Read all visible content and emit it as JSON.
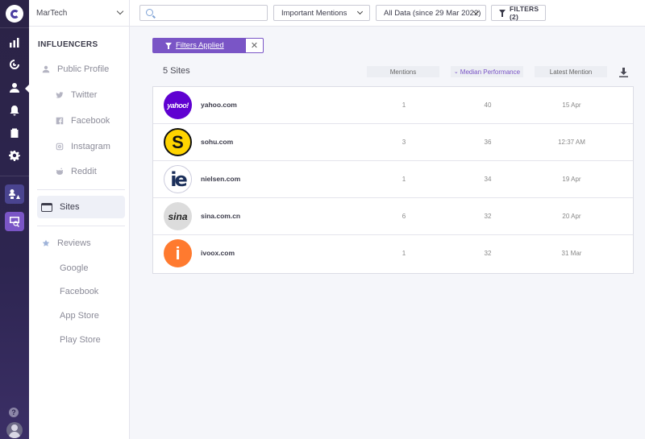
{
  "workspace": {
    "name": "MarTech"
  },
  "topbar": {
    "search_placeholder": "",
    "mentions_filter": "Important Mentions",
    "date_filter": "All Data (since 29 Mar 2022)",
    "filters_label": "FILTERS (2)"
  },
  "sidebar": {
    "section_title": "INFLUENCERS",
    "items": [
      {
        "label": "Public Profile",
        "icon": "person-icon"
      },
      {
        "label": "Twitter",
        "icon": "twitter-icon"
      },
      {
        "label": "Facebook",
        "icon": "facebook-icon"
      },
      {
        "label": "Instagram",
        "icon": "instagram-icon"
      },
      {
        "label": "Reddit",
        "icon": "reddit-icon"
      }
    ],
    "active_item": {
      "label": "Sites",
      "icon": "window-icon"
    },
    "reviews": {
      "label": "Reviews",
      "icon": "star-icon",
      "children": [
        "Google",
        "Facebook",
        "App Store",
        "Play Store"
      ]
    }
  },
  "filters_applied": {
    "label": "Filters Applied",
    "close": "✕"
  },
  "table": {
    "count_label": "5 Sites",
    "columns": [
      "Mentions",
      "Median Performance",
      "Latest Mention"
    ],
    "sorted_column": "Median Performance",
    "rows": [
      {
        "logo_text": "yahoo!",
        "name": "yahoo.com",
        "mentions": "1",
        "performance": "40",
        "latest": "15 Apr"
      },
      {
        "logo_text": "S",
        "name": "sohu.com",
        "mentions": "3",
        "performance": "36",
        "latest": "12:37 AM"
      },
      {
        "logo_text": "ie",
        "name": "nielsen.com",
        "mentions": "1",
        "performance": "34",
        "latest": "19 Apr"
      },
      {
        "logo_text": "sina",
        "name": "sina.com.cn",
        "mentions": "6",
        "performance": "32",
        "latest": "20 Apr"
      },
      {
        "logo_text": "i",
        "name": "ivoox.com",
        "mentions": "1",
        "performance": "32",
        "latest": "31 Mar"
      }
    ]
  },
  "colors": {
    "accent": "#7a55c6",
    "rail": "#2d2550"
  }
}
